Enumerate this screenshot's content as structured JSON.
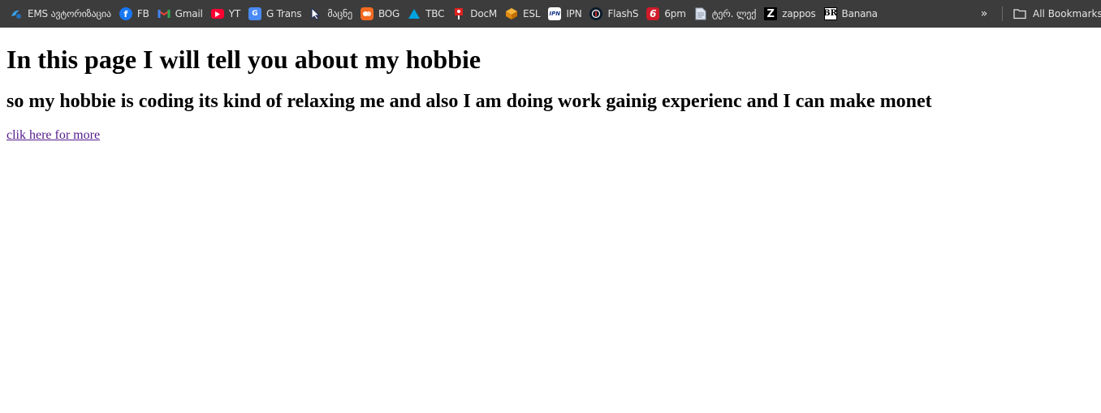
{
  "bookmarks_bar": {
    "items": [
      {
        "label": "EMS ავტორიზაცია",
        "icon": "ems-logo-icon"
      },
      {
        "label": "FB",
        "icon": "facebook-icon"
      },
      {
        "label": "Gmail",
        "icon": "gmail-icon"
      },
      {
        "label": "YT",
        "icon": "youtube-icon"
      },
      {
        "label": "G Trans",
        "icon": "google-translate-icon"
      },
      {
        "label": "მაცნე",
        "icon": "cursor-arrow-icon"
      },
      {
        "label": "BOG",
        "icon": "bog-bank-icon"
      },
      {
        "label": "TBC",
        "icon": "tbc-triangle-icon"
      },
      {
        "label": "DocM",
        "icon": "docm-pin-icon"
      },
      {
        "label": "ESL",
        "icon": "esl-box-icon"
      },
      {
        "label": "IPN",
        "icon": "ipn-icon"
      },
      {
        "label": "FlashS",
        "icon": "flashscore-icon"
      },
      {
        "label": "6pm",
        "icon": "6pm-icon"
      },
      {
        "label": "ტერ. ლექ",
        "icon": "document-icon"
      },
      {
        "label": "zappos",
        "icon": "zappos-z-icon"
      },
      {
        "label": "Banana",
        "icon": "banana-republic-icon"
      }
    ],
    "overflow_glyph": "»",
    "all_bookmarks_label": "All Bookmarks"
  },
  "main": {
    "heading": "In this page I will tell you about my hobbie",
    "subheading": "so my hobbie is coding its kind of relaxing me and also I am doing work gainig experienc and I can make monet",
    "link_text": "clik here for more"
  },
  "colors": {
    "toolbar_bg": "#3c3c3c",
    "toolbar_text": "#e3e3e3",
    "visited_link": "#551a8b"
  }
}
